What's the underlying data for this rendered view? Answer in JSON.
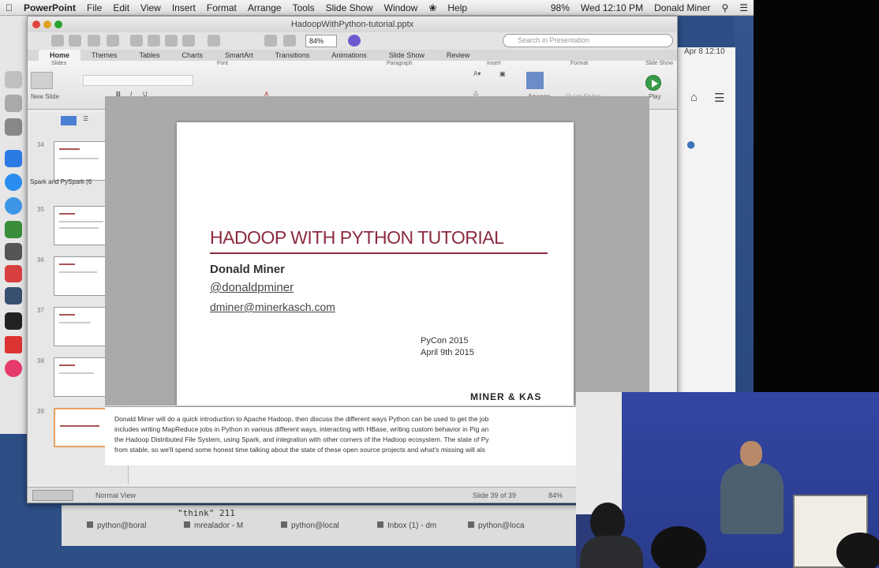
{
  "menubar": {
    "apple": "",
    "app": "PowerPoint",
    "items": [
      "File",
      "Edit",
      "View",
      "Insert",
      "Format",
      "Arrange",
      "Tools",
      "Slide Show",
      "Window",
      "Help"
    ],
    "battery": "98%",
    "clock": "Wed 12:10 PM",
    "user": "Donald Miner"
  },
  "window": {
    "title": "HadoopWithPython-tutorial.pptx",
    "zoom": "84%",
    "search_placeholder": "Search in Presentation"
  },
  "ribbon": {
    "tabs": [
      "Home",
      "Themes",
      "Tables",
      "Charts",
      "SmartArt",
      "Transitions",
      "Animations",
      "Slide Show",
      "Review"
    ],
    "active_tab": "Home",
    "groups": [
      "Slides",
      "Font",
      "Paragraph",
      "Insert",
      "Format",
      "Slide Show"
    ],
    "new_slide_label": "New Slide",
    "arrange_label": "Arrange",
    "quick_styles_label": "Quick Styles",
    "play_label": "Play"
  },
  "thumbnails": {
    "section_label": "Spark and PySpark (6",
    "slide_numbers": [
      "34",
      "35",
      "36",
      "37",
      "38",
      "39"
    ],
    "selected": "39"
  },
  "slide": {
    "title": "HADOOP WITH PYTHON TUTORIAL",
    "name": "Donald Miner",
    "handle": "@donaldpminer",
    "email": "dminer@minerkasch.com",
    "conference": "PyCon 2015",
    "date": "April 9th 2015",
    "logo": "MINER & KAS"
  },
  "notes": {
    "lines": [
      "Donald Miner will do a quick introduction to Apache Hadoop, then discuss the different ways Python can be used to get the job",
      "includes writing MapReduce jobs in Python in various different ways, interacting with HBase, writing custom behavior in Pig an",
      "the Hadoop Distributed File System, using Spark, and integration with other corners of the Hadoop ecosystem. The state of Py",
      "from stable, so we'll spend some honest time talking about the state of these open source projects and what's missing will als"
    ]
  },
  "statusbar": {
    "view": "Normal View",
    "slide_count": "Slide 39 of 39",
    "zoom": "84%"
  },
  "background": {
    "browser_clock": "Apr 8 12:10",
    "terminal_text": "\"think\" 211",
    "taskbar_items": [
      "python@boral",
      "mrealador - M",
      "python@local",
      "Inbox (1) - dm",
      "python@loca"
    ]
  }
}
